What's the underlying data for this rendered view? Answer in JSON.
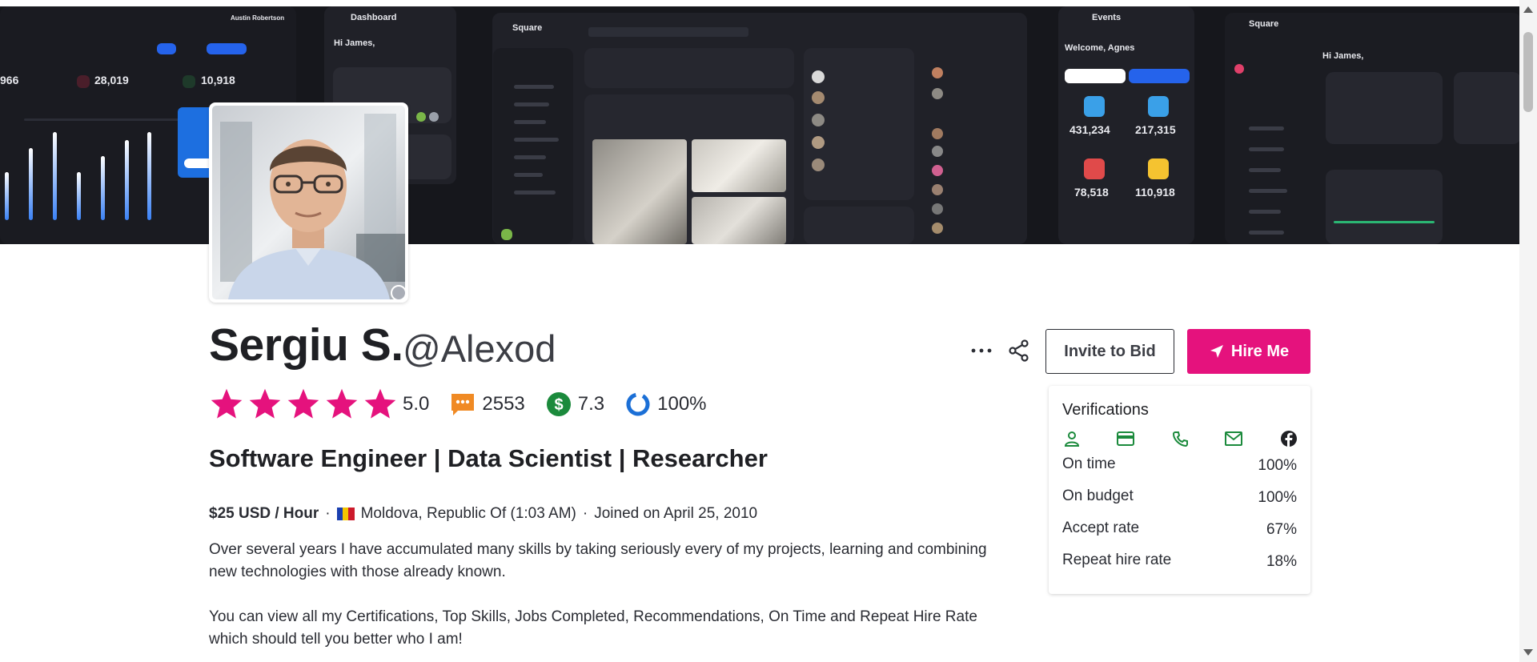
{
  "profile": {
    "name": "Sergiu S.",
    "handle": "@Alexod",
    "headline": "Software Engineer | Data Scientist | Researcher",
    "rating": "5.0",
    "star_count": 5,
    "reviews": "2553",
    "earnings_score": "7.3",
    "completion": "100%",
    "hourly_rate": "$25 USD / Hour",
    "location": "Moldova, Republic Of (1:03 AM)",
    "joined": "Joined on April 25, 2010",
    "bio": [
      "Over several years I have accumulated many skills by taking seriously every of my projects, learning and combining new technologies with those already known.",
      "You can view all my Certifications, Top Skills, Jobs Completed, Recommendations, On Time and Repeat Hire Rate which should tell you better who I am!"
    ]
  },
  "actions": {
    "more_icon": "more-horizontal-icon",
    "share_icon": "share-icon",
    "invite_label": "Invite to Bid",
    "hire_label": "Hire Me"
  },
  "verifications": {
    "title": "Verifications",
    "icons": [
      "user-icon",
      "credit-card-icon",
      "phone-icon",
      "email-icon",
      "facebook-icon"
    ],
    "rows": [
      {
        "label": "On time",
        "value": "100%"
      },
      {
        "label": "On budget",
        "value": "100%"
      },
      {
        "label": "Accept rate",
        "value": "67%"
      },
      {
        "label": "Repeat hire rate",
        "value": "18%"
      }
    ]
  },
  "cover": {
    "texts": [
      "Austin Robertson",
      "Dashboard",
      "Hi James,",
      "Square",
      "Events",
      "Welcome, Agnes",
      "Hi James,"
    ],
    "numbers": [
      "966",
      "28,019",
      "10,918",
      "431,234",
      "217,315",
      "78,518",
      "110,918"
    ]
  },
  "colors": {
    "accent": "#e5127d",
    "star": "#e5127d",
    "review_badge": "#f08a24",
    "earnings": "#1b8a3c",
    "completion": "#1b6fd6",
    "verified": "#1b8a3c"
  }
}
